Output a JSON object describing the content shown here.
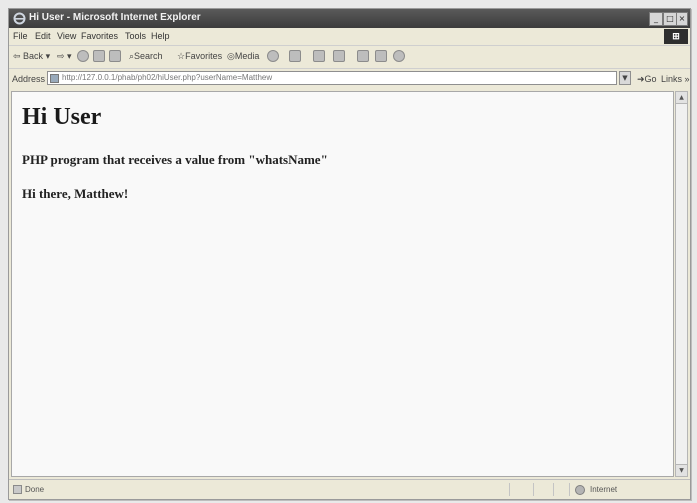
{
  "window": {
    "title": "Hi User - Microsoft Internet Explorer",
    "minimize": "_",
    "maximize": "□",
    "close": "×"
  },
  "menu": [
    "File",
    "Edit",
    "View",
    "Favorites",
    "Tools",
    "Help"
  ],
  "toolbar": {
    "back_label": "Back",
    "search_label": "Search",
    "favorites_label": "Favorites",
    "media_label": "Media"
  },
  "address": {
    "label": "Address",
    "url": "http://127.0.0.1/phab/ph02/hiUser.php?userName=Matthew",
    "go_label": "Go",
    "links_label": "Links"
  },
  "page": {
    "heading": "Hi User",
    "subheading": "PHP program that receives a value from \"whatsName\"",
    "greeting": "Hi there, Matthew!"
  },
  "status": {
    "text": "Done",
    "zone": "Internet"
  }
}
